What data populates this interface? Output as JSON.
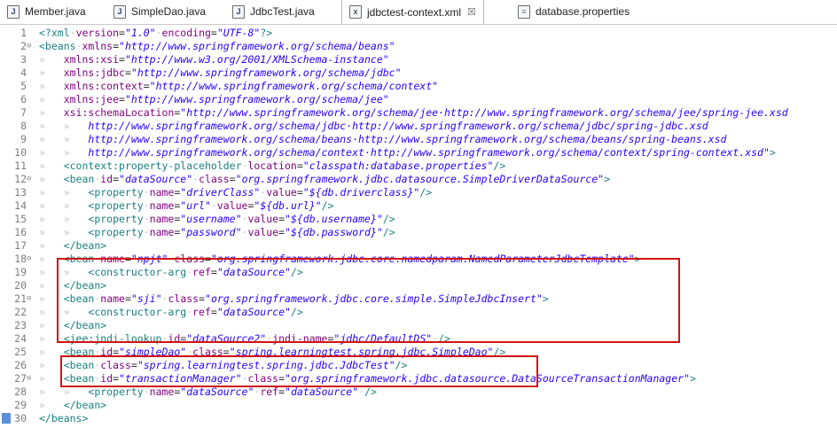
{
  "tabs": [
    {
      "label": "Member.java",
      "icon": "java-file-icon",
      "icon_glyph": "J",
      "active": false
    },
    {
      "label": "SimpleDao.java",
      "icon": "java-file-icon",
      "icon_glyph": "J",
      "active": false
    },
    {
      "label": "JdbcTest.java",
      "icon": "java-file-icon",
      "icon_glyph": "J",
      "active": false
    },
    {
      "label": "jdbctest-context.xml",
      "icon": "xml-file-icon",
      "icon_glyph": "x",
      "active": true,
      "close": "☒"
    },
    {
      "label": "database.properties",
      "icon": "properties-file-icon",
      "icon_glyph": "≡",
      "active": false
    }
  ],
  "colors": {
    "tag": "#1a7f7f",
    "attribute": "#7f007f",
    "value": "#2a00ff",
    "highlight_box": "#d21414"
  },
  "editor": {
    "lines": [
      {
        "n": "1",
        "fold": "",
        "tokens": [
          [
            "tag",
            "<?xml"
          ],
          [
            "ws",
            "·"
          ],
          [
            "attr",
            "version"
          ],
          [
            "plain",
            "="
          ],
          [
            "val",
            "\"1.0\""
          ],
          [
            "ws",
            "·"
          ],
          [
            "attr",
            "encoding"
          ],
          [
            "plain",
            "="
          ],
          [
            "val",
            "\"UTF-8\""
          ],
          [
            "tag",
            "?>"
          ]
        ]
      },
      {
        "n": "2",
        "fold": "⊖",
        "tokens": [
          [
            "tag",
            "<beans"
          ],
          [
            "ws",
            "·"
          ],
          [
            "attr",
            "xmlns"
          ],
          [
            "plain",
            "="
          ],
          [
            "val",
            "\"http://www.springframework.org/schema/beans\""
          ]
        ]
      },
      {
        "n": "3",
        "fold": "",
        "tokens": [
          [
            "ws",
            "»   "
          ],
          [
            "attr",
            "xmlns:xsi"
          ],
          [
            "plain",
            "="
          ],
          [
            "val",
            "\"http://www.w3.org/2001/XMLSchema-instance\""
          ]
        ]
      },
      {
        "n": "4",
        "fold": "",
        "tokens": [
          [
            "ws",
            "»   "
          ],
          [
            "attr",
            "xmlns:jdbc"
          ],
          [
            "plain",
            "="
          ],
          [
            "val",
            "\"http://www.springframework.org/schema/jdbc\""
          ]
        ]
      },
      {
        "n": "5",
        "fold": "",
        "tokens": [
          [
            "ws",
            "»   "
          ],
          [
            "attr",
            "xmlns:context"
          ],
          [
            "plain",
            "="
          ],
          [
            "val",
            "\"http://www.springframework.org/schema/context\""
          ]
        ]
      },
      {
        "n": "6",
        "fold": "",
        "tokens": [
          [
            "ws",
            "»   "
          ],
          [
            "attr",
            "xmlns:jee"
          ],
          [
            "plain",
            "="
          ],
          [
            "val",
            "\"http://www.springframework.org/schema/jee\""
          ]
        ]
      },
      {
        "n": "7",
        "fold": "",
        "tokens": [
          [
            "ws",
            "»   "
          ],
          [
            "attr",
            "xsi:schemaLocation"
          ],
          [
            "plain",
            "="
          ],
          [
            "val",
            "\"http://www.springframework.org/schema/jee·http://www.springframework.org/schema/jee/spring-jee.xsd"
          ]
        ]
      },
      {
        "n": "8",
        "fold": "",
        "tokens": [
          [
            "ws",
            "»   »   "
          ],
          [
            "val",
            "http://www.springframework.org/schema/jdbc·http://www.springframework.org/schema/jdbc/spring-jdbc.xsd"
          ]
        ]
      },
      {
        "n": "9",
        "fold": "",
        "tokens": [
          [
            "ws",
            "»   »   "
          ],
          [
            "val",
            "http://www.springframework.org/schema/beans·http://www.springframework.org/schema/beans/spring-beans.xsd"
          ]
        ]
      },
      {
        "n": "10",
        "fold": "",
        "tokens": [
          [
            "ws",
            "»   »   "
          ],
          [
            "val",
            "http://www.springframework.org/schema/context·http://www.springframework.org/schema/context/spring-context.xsd\""
          ],
          [
            "tag",
            ">"
          ]
        ]
      },
      {
        "n": "11",
        "fold": "",
        "tokens": [
          [
            "ws",
            "»   "
          ],
          [
            "tag",
            "<context:property-placeholder"
          ],
          [
            "ws",
            "·"
          ],
          [
            "attr",
            "location"
          ],
          [
            "plain",
            "="
          ],
          [
            "val",
            "\"classpath:database.properties\""
          ],
          [
            "tag",
            "/>"
          ]
        ]
      },
      {
        "n": "12",
        "fold": "⊖",
        "tokens": [
          [
            "ws",
            "»   "
          ],
          [
            "tag",
            "<bean"
          ],
          [
            "ws",
            "·"
          ],
          [
            "attr",
            "id"
          ],
          [
            "plain",
            "="
          ],
          [
            "val",
            "\"dataSource\""
          ],
          [
            "ws",
            "·"
          ],
          [
            "attr",
            "class"
          ],
          [
            "plain",
            "="
          ],
          [
            "val",
            "\"org.springframework.jdbc.datasource.SimpleDriverDataSource\""
          ],
          [
            "tag",
            ">"
          ]
        ]
      },
      {
        "n": "13",
        "fold": "",
        "tokens": [
          [
            "ws",
            "»   »   "
          ],
          [
            "tag",
            "<property"
          ],
          [
            "ws",
            "·"
          ],
          [
            "attr",
            "name"
          ],
          [
            "plain",
            "="
          ],
          [
            "val",
            "\"driverClass\""
          ],
          [
            "ws",
            "·"
          ],
          [
            "attr",
            "value"
          ],
          [
            "plain",
            "="
          ],
          [
            "val",
            "\"${db.driverclass}\""
          ],
          [
            "tag",
            "/>"
          ]
        ]
      },
      {
        "n": "14",
        "fold": "",
        "tokens": [
          [
            "ws",
            "»   »   "
          ],
          [
            "tag",
            "<property"
          ],
          [
            "ws",
            "·"
          ],
          [
            "attr",
            "name"
          ],
          [
            "plain",
            "="
          ],
          [
            "val",
            "\"url\""
          ],
          [
            "ws",
            "·"
          ],
          [
            "attr",
            "value"
          ],
          [
            "plain",
            "="
          ],
          [
            "val",
            "\"${db.url}\""
          ],
          [
            "tag",
            "/>"
          ]
        ]
      },
      {
        "n": "15",
        "fold": "",
        "tokens": [
          [
            "ws",
            "»   »   "
          ],
          [
            "tag",
            "<property"
          ],
          [
            "ws",
            "·"
          ],
          [
            "attr",
            "name"
          ],
          [
            "plain",
            "="
          ],
          [
            "val",
            "\"username\""
          ],
          [
            "ws",
            "·"
          ],
          [
            "attr",
            "value"
          ],
          [
            "plain",
            "="
          ],
          [
            "val",
            "\"${db.username}\""
          ],
          [
            "tag",
            "/>"
          ]
        ]
      },
      {
        "n": "16",
        "fold": "",
        "tokens": [
          [
            "ws",
            "»   »   "
          ],
          [
            "tag",
            "<property"
          ],
          [
            "ws",
            "·"
          ],
          [
            "attr",
            "name"
          ],
          [
            "plain",
            "="
          ],
          [
            "val",
            "\"password\""
          ],
          [
            "ws",
            "·"
          ],
          [
            "attr",
            "value"
          ],
          [
            "plain",
            "="
          ],
          [
            "val",
            "\"${db.password}\""
          ],
          [
            "tag",
            "/>"
          ]
        ]
      },
      {
        "n": "17",
        "fold": "",
        "tokens": [
          [
            "ws",
            "»   "
          ],
          [
            "tag",
            "</bean>"
          ]
        ]
      },
      {
        "n": "18",
        "fold": "⊖",
        "tokens": [
          [
            "ws",
            "»   "
          ],
          [
            "tag",
            "<bean"
          ],
          [
            "ws",
            "·"
          ],
          [
            "attr",
            "name"
          ],
          [
            "plain",
            "="
          ],
          [
            "val",
            "\"npjt\""
          ],
          [
            "ws",
            "·"
          ],
          [
            "attr",
            "class"
          ],
          [
            "plain",
            "="
          ],
          [
            "val",
            "\"org.springframework.jdbc.core.namedparam.NamedParameterJdbcTemplate\""
          ],
          [
            "tag",
            ">"
          ]
        ]
      },
      {
        "n": "19",
        "fold": "",
        "tokens": [
          [
            "ws",
            "»   »   "
          ],
          [
            "tag",
            "<constructor-arg"
          ],
          [
            "ws",
            "·"
          ],
          [
            "attr",
            "ref"
          ],
          [
            "plain",
            "="
          ],
          [
            "val",
            "\"dataSource\""
          ],
          [
            "tag",
            "/>"
          ]
        ]
      },
      {
        "n": "20",
        "fold": "",
        "tokens": [
          [
            "ws",
            "»   "
          ],
          [
            "tag",
            "</bean>"
          ]
        ]
      },
      {
        "n": "21",
        "fold": "⊖",
        "tokens": [
          [
            "ws",
            "»   "
          ],
          [
            "tag",
            "<bean"
          ],
          [
            "ws",
            "·"
          ],
          [
            "attr",
            "name"
          ],
          [
            "plain",
            "="
          ],
          [
            "val",
            "\"sji\""
          ],
          [
            "ws",
            "·"
          ],
          [
            "attr",
            "class"
          ],
          [
            "plain",
            "="
          ],
          [
            "val",
            "\"org.springframework.jdbc.core.simple.SimpleJdbcInsert\""
          ],
          [
            "tag",
            ">"
          ]
        ]
      },
      {
        "n": "22",
        "fold": "",
        "tokens": [
          [
            "ws",
            "»   »   "
          ],
          [
            "tag",
            "<constructor-arg"
          ],
          [
            "ws",
            "·"
          ],
          [
            "attr",
            "ref"
          ],
          [
            "plain",
            "="
          ],
          [
            "val",
            "\"dataSource\""
          ],
          [
            "tag",
            "/>"
          ]
        ]
      },
      {
        "n": "23",
        "fold": "",
        "tokens": [
          [
            "ws",
            "»   "
          ],
          [
            "tag",
            "</bean>"
          ]
        ]
      },
      {
        "n": "24",
        "fold": "",
        "tokens": [
          [
            "ws",
            "»   "
          ],
          [
            "tag",
            "<jee:jndi-lookup"
          ],
          [
            "ws",
            "·"
          ],
          [
            "attr",
            "id"
          ],
          [
            "plain",
            "="
          ],
          [
            "val",
            "\"dataSource2\""
          ],
          [
            "ws",
            "·"
          ],
          [
            "attr",
            "jndi-name"
          ],
          [
            "plain",
            "="
          ],
          [
            "val",
            "\"jdbc/DefaultDS\""
          ],
          [
            "ws",
            "·"
          ],
          [
            "tag",
            "/>"
          ]
        ]
      },
      {
        "n": "25",
        "fold": "",
        "tokens": [
          [
            "ws",
            "»   "
          ],
          [
            "tag",
            "<bean"
          ],
          [
            "ws",
            "·"
          ],
          [
            "attr",
            "id"
          ],
          [
            "plain",
            "="
          ],
          [
            "val",
            "\"simpleDao\""
          ],
          [
            "ws",
            "·"
          ],
          [
            "attr",
            "class"
          ],
          [
            "plain",
            "="
          ],
          [
            "val",
            "\"spring.learningtest.spring.jdbc.SimpleDao\""
          ],
          [
            "tag",
            "/>"
          ]
        ]
      },
      {
        "n": "26",
        "fold": "",
        "tokens": [
          [
            "ws",
            "»   "
          ],
          [
            "tag",
            "<bean"
          ],
          [
            "ws",
            "·"
          ],
          [
            "attr",
            "class"
          ],
          [
            "plain",
            "="
          ],
          [
            "val",
            "\"spring.learningtest.spring.jdbc.JdbcTest\""
          ],
          [
            "tag",
            "/>"
          ]
        ]
      },
      {
        "n": "27",
        "fold": "⊖",
        "tokens": [
          [
            "ws",
            "»   "
          ],
          [
            "tag",
            "<bean"
          ],
          [
            "ws",
            "·"
          ],
          [
            "attr",
            "id"
          ],
          [
            "plain",
            "="
          ],
          [
            "val",
            "\"transactionManager\""
          ],
          [
            "ws",
            "·"
          ],
          [
            "attr",
            "class"
          ],
          [
            "plain",
            "="
          ],
          [
            "val",
            "\"org.springframework.jdbc.datasource.DataSourceTransactionManager\""
          ],
          [
            "tag",
            ">"
          ]
        ]
      },
      {
        "n": "28",
        "fold": "",
        "tokens": [
          [
            "ws",
            "»   »   "
          ],
          [
            "tag",
            "<property"
          ],
          [
            "ws",
            "·"
          ],
          [
            "attr",
            "name"
          ],
          [
            "plain",
            "="
          ],
          [
            "val",
            "\"dataSource\""
          ],
          [
            "ws",
            "·"
          ],
          [
            "attr",
            "ref"
          ],
          [
            "plain",
            "="
          ],
          [
            "val",
            "\"dataSource\""
          ],
          [
            "ws",
            "·"
          ],
          [
            "tag",
            "/>"
          ]
        ]
      },
      {
        "n": "29",
        "fold": "",
        "tokens": [
          [
            "ws",
            "»   "
          ],
          [
            "tag",
            "</bean>"
          ]
        ]
      },
      {
        "n": "30",
        "fold": "",
        "tokens": [
          [
            "tag",
            "</beans>"
          ]
        ]
      }
    ]
  }
}
